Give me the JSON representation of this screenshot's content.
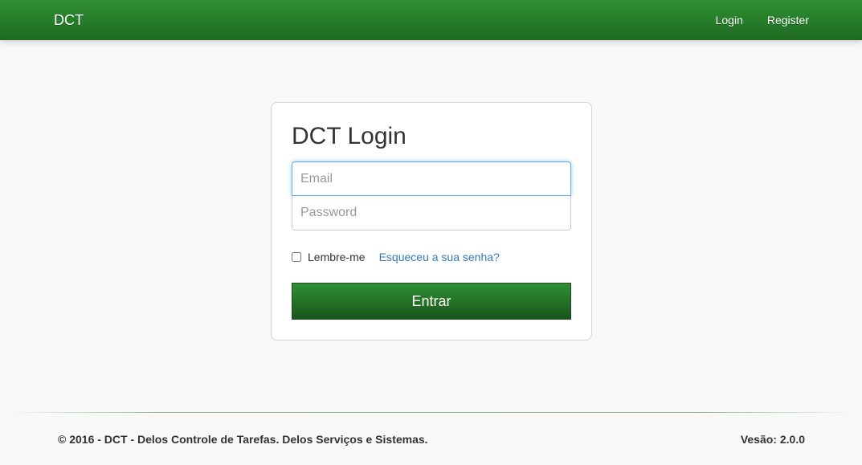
{
  "navbar": {
    "brand": "DCT",
    "links": [
      {
        "label": "Login"
      },
      {
        "label": "Register"
      }
    ],
    "colors": {
      "gradient_top": "#2f8f33",
      "gradient_bottom": "#1f6b22"
    }
  },
  "login_panel": {
    "title": "DCT Login",
    "email": {
      "placeholder": "Email",
      "value": ""
    },
    "password": {
      "placeholder": "Password",
      "value": ""
    },
    "remember_label": "Lembre-me",
    "remember_checked": false,
    "forgot_link": "Esqueceu a sua senha?",
    "submit_label": "Entrar"
  },
  "footer": {
    "copyright": "© 2016 - DCT - Delos Controle de Tarefas. Delos Serviços e Sistemas.",
    "version": "Vesão: 2.0.0"
  }
}
